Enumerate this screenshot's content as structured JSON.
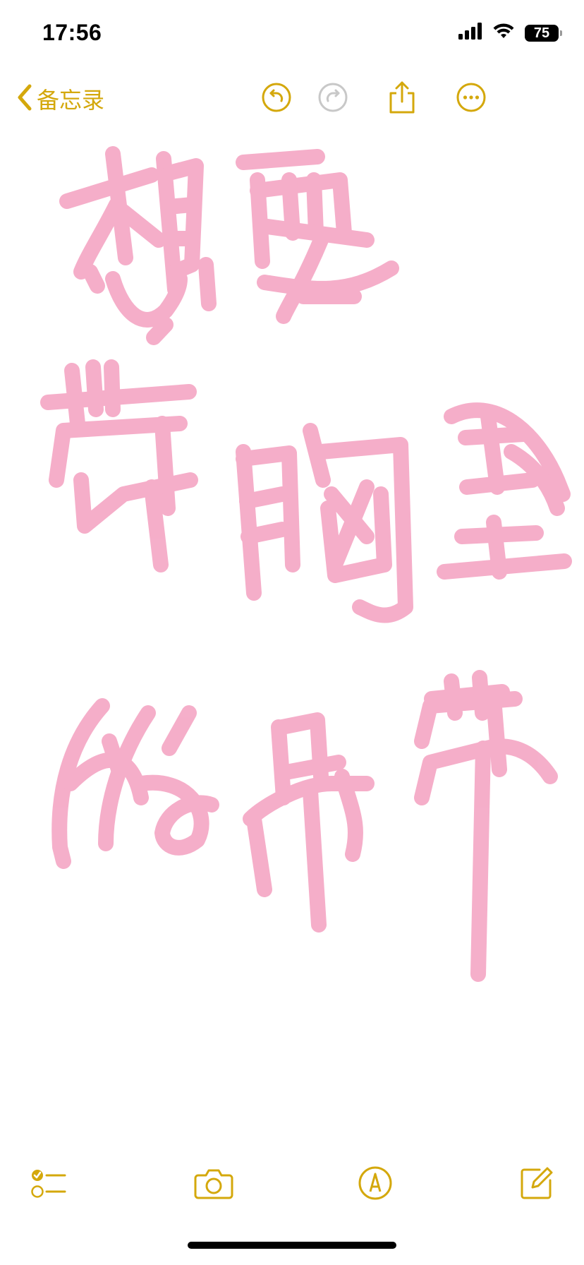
{
  "status_bar": {
    "time": "17:56",
    "battery": "75",
    "icons": [
      "signal-icon",
      "wifi-icon",
      "battery-icon"
    ]
  },
  "nav": {
    "back_label": "备忘录",
    "icons": [
      "chevron-left-icon",
      "undo-icon",
      "redo-icon",
      "share-icon",
      "more-icon"
    ],
    "redo_enabled": false
  },
  "note": {
    "content_type": "handwritten drawing",
    "ink_color": "#F4A6C4",
    "lines": [
      "想要",
      "带胸垫",
      "的吊带"
    ]
  },
  "toolbar": {
    "icons": [
      "checklist-icon",
      "camera-icon",
      "markup-pen-icon",
      "compose-icon"
    ]
  },
  "colors": {
    "accent": "#D4A80C",
    "disabled": "#C8C8C8",
    "ink": "#F4A6C4",
    "background": "#FFFFFF"
  }
}
